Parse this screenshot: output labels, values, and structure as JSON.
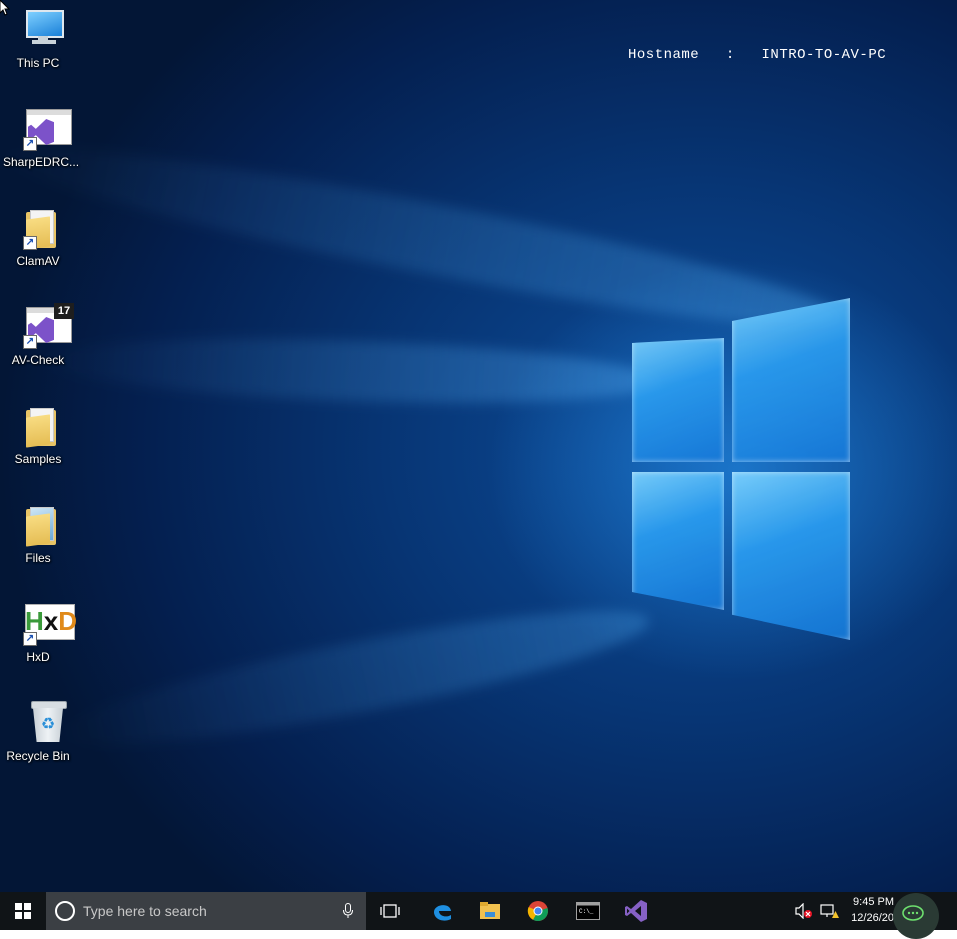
{
  "desktop": {
    "hostname_text": "Hostname   :   INTRO-TO-AV-PC",
    "icons": [
      {
        "label": "This PC",
        "icon": "this-pc-icon"
      },
      {
        "label": "SharpEDRC...",
        "icon": "visual-studio-project-icon"
      },
      {
        "label": "ClamAV",
        "icon": "folder-icon"
      },
      {
        "label": "AV-Check",
        "icon": "visual-studio-2017-icon",
        "badge": "17"
      },
      {
        "label": "Samples",
        "icon": "folder-icon"
      },
      {
        "label": "Files",
        "icon": "folder-icon"
      },
      {
        "label": "HxD",
        "icon": "hxd-icon"
      },
      {
        "label": "Recycle Bin",
        "icon": "recycle-bin-icon"
      }
    ]
  },
  "taskbar": {
    "search_placeholder": "Type here to search",
    "pinned": [
      "task-view-icon",
      "edge-icon",
      "file-explorer-icon",
      "chrome-icon",
      "command-prompt-icon",
      "visual-studio-icon"
    ],
    "tray": {
      "time": "9:45 PM",
      "date": "12/26/20"
    }
  },
  "colors": {
    "accent": "#0078d7",
    "taskbar": "#101417",
    "search_box": "#3b3f44",
    "vs_purple": "#7c52c9"
  }
}
